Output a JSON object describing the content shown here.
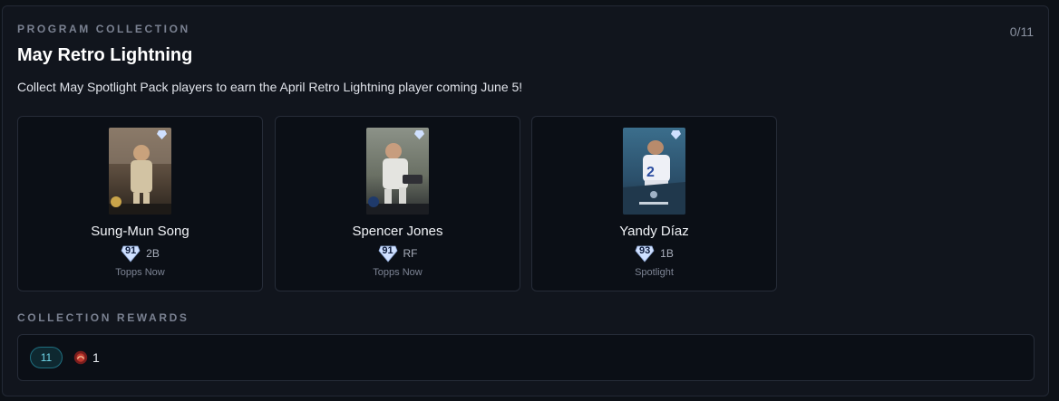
{
  "header": {
    "eyebrow": "PROGRAM COLLECTION",
    "counter": "0/11",
    "title": "May Retro Lightning",
    "description": "Collect May Spotlight Pack players to earn the April Retro Lightning player coming June 5!"
  },
  "players": [
    {
      "name": "Sung-Mun Song",
      "ovr": "91",
      "position": "2B",
      "series": "Topps Now"
    },
    {
      "name": "Spencer Jones",
      "ovr": "91",
      "position": "RF",
      "series": "Topps Now"
    },
    {
      "name": "Yandy Díaz",
      "ovr": "93",
      "position": "1B",
      "series": "Spotlight"
    }
  ],
  "rewards": {
    "heading": "COLLECTION REWARDS",
    "badge": "11",
    "icon": "pack-icon",
    "quantity": "1"
  },
  "colors": {
    "background": "#0d1117",
    "accent": "#6fd6e8",
    "diamond_rating": "#cfe0ff"
  }
}
